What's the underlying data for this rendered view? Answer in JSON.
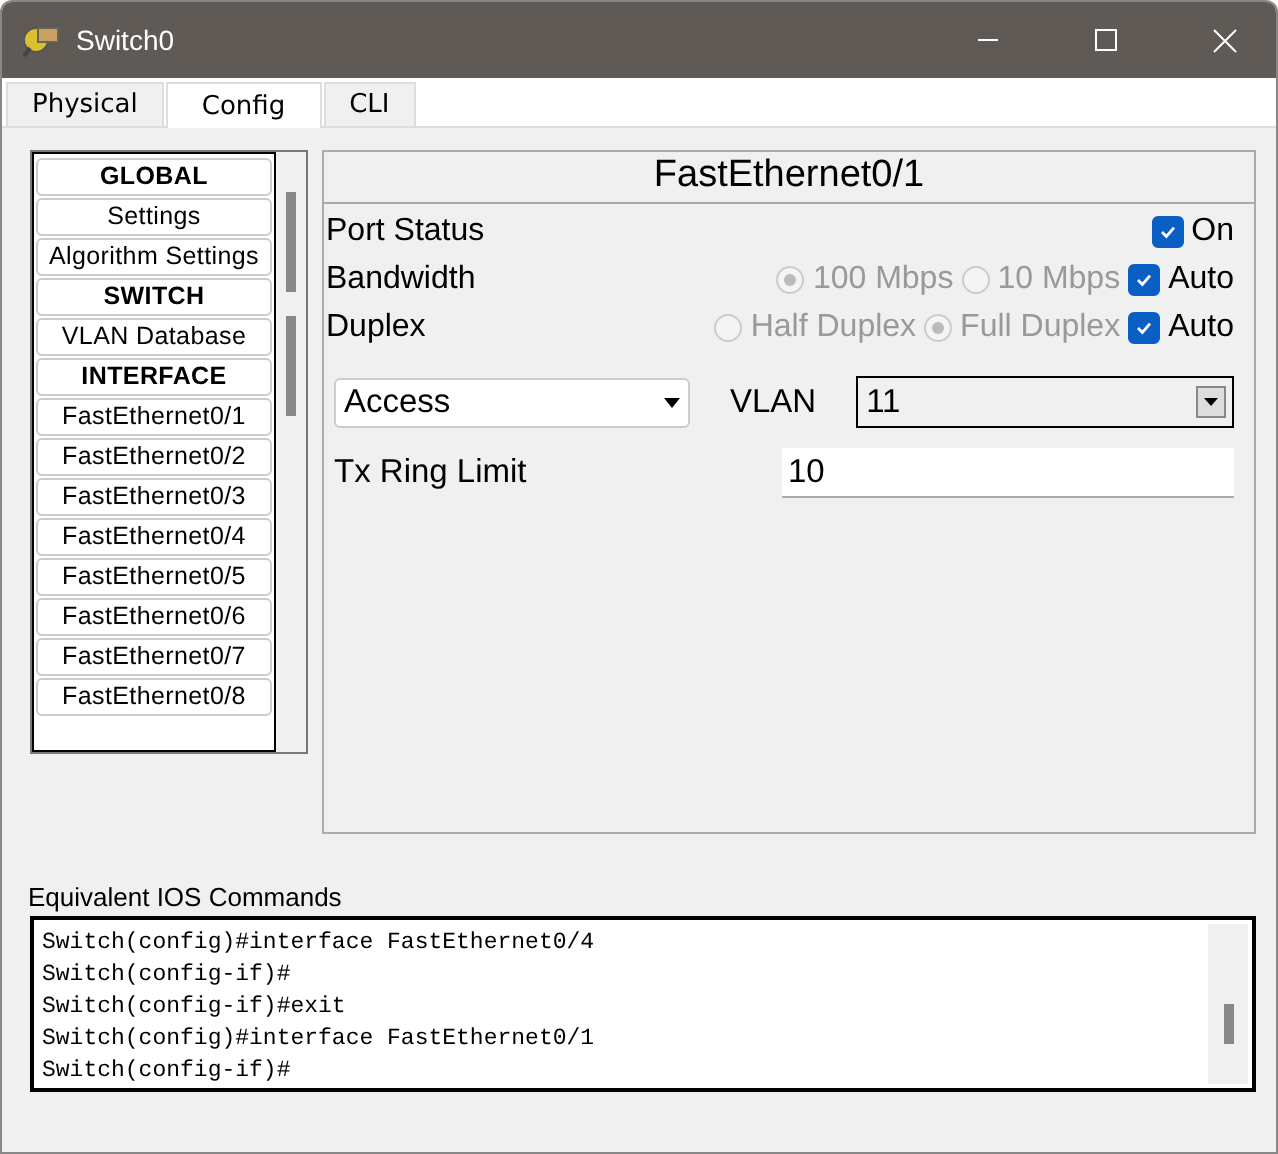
{
  "window": {
    "title": "Switch0"
  },
  "tabs": [
    {
      "label": "Physical",
      "selected": false
    },
    {
      "label": "Config",
      "selected": true
    },
    {
      "label": "CLI",
      "selected": false
    }
  ],
  "sidebar": {
    "items": [
      {
        "kind": "header",
        "label": "GLOBAL",
        "selected": false
      },
      {
        "kind": "item",
        "label": "Settings",
        "selected": false
      },
      {
        "kind": "item",
        "label": "Algorithm Settings",
        "selected": false
      },
      {
        "kind": "header",
        "label": "SWITCH",
        "selected": false
      },
      {
        "kind": "item",
        "label": "VLAN Database",
        "selected": false
      },
      {
        "kind": "header",
        "label": "INTERFACE",
        "selected": false
      },
      {
        "kind": "item",
        "label": "FastEthernet0/1",
        "selected": false
      },
      {
        "kind": "item",
        "label": "FastEthernet0/2",
        "selected": false
      },
      {
        "kind": "item",
        "label": "FastEthernet0/3",
        "selected": false
      },
      {
        "kind": "item",
        "label": "FastEthernet0/4",
        "selected": false
      },
      {
        "kind": "item",
        "label": "FastEthernet0/5",
        "selected": false
      },
      {
        "kind": "item",
        "label": "FastEthernet0/6",
        "selected": false
      },
      {
        "kind": "item",
        "label": "FastEthernet0/7",
        "selected": false
      },
      {
        "kind": "item",
        "label": "FastEthernet0/8",
        "selected": false
      }
    ]
  },
  "panel": {
    "title": "FastEthernet0/1",
    "port_status": {
      "label": "Port Status",
      "checkbox": {
        "label": "On",
        "checked": true
      }
    },
    "bandwidth": {
      "label": "Bandwidth",
      "options": [
        {
          "label": "100 Mbps",
          "selected": true,
          "disabled": true
        },
        {
          "label": "10 Mbps",
          "selected": false,
          "disabled": true
        }
      ],
      "auto": {
        "label": "Auto",
        "checked": true
      }
    },
    "duplex": {
      "label": "Duplex",
      "options": [
        {
          "label": "Half Duplex",
          "selected": false,
          "disabled": true
        },
        {
          "label": "Full Duplex",
          "selected": true,
          "disabled": true
        }
      ],
      "auto": {
        "label": "Auto",
        "checked": true
      }
    },
    "mode": {
      "value": "Access"
    },
    "vlan": {
      "label": "VLAN",
      "value": "11"
    },
    "tx_ring_limit": {
      "label": "Tx Ring Limit",
      "value": "10"
    }
  },
  "ios_commands": {
    "label": "Equivalent IOS Commands",
    "lines": [
      "Switch(config)#interface FastEthernet0/4",
      "Switch(config-if)#",
      "Switch(config-if)#exit",
      "Switch(config)#interface FastEthernet0/1",
      "Switch(config-if)#"
    ]
  }
}
